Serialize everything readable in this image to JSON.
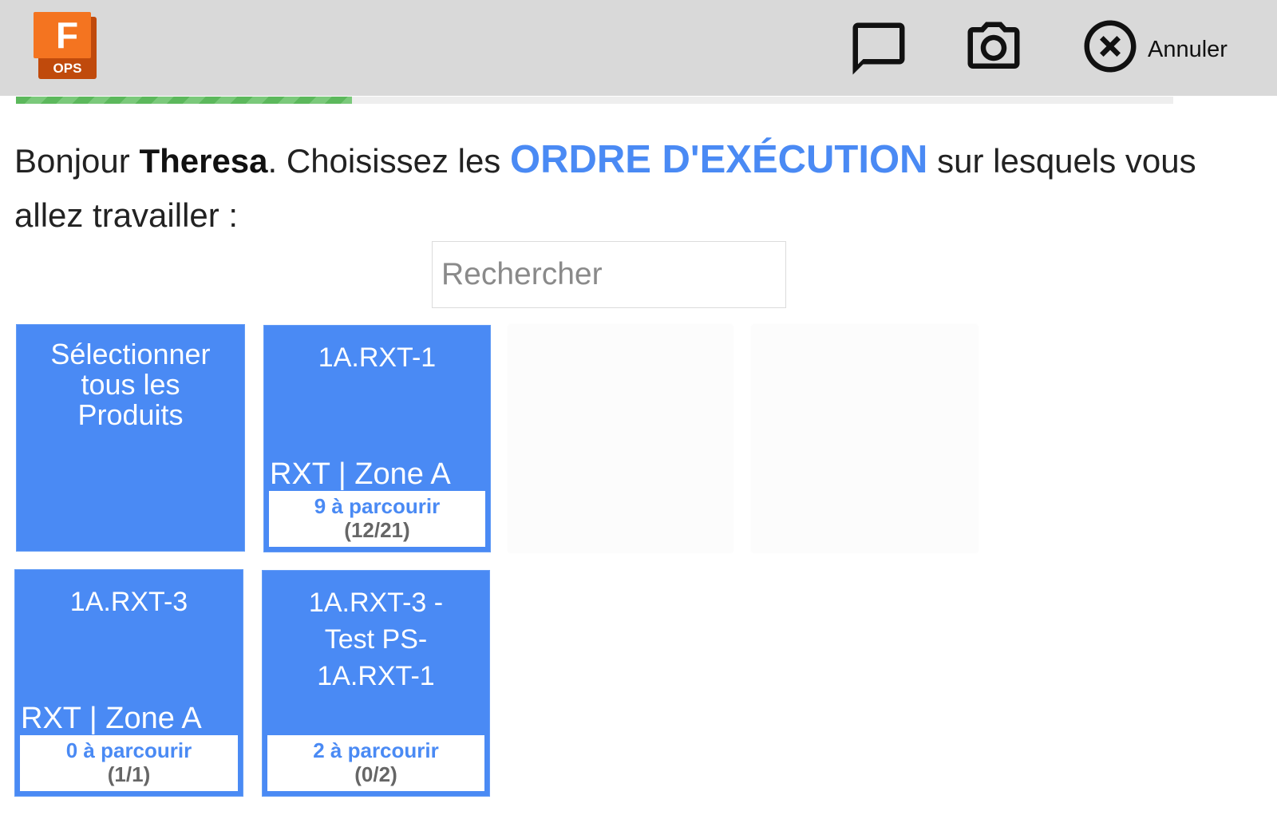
{
  "app": {
    "logo_letter": "F",
    "logo_product": "OPS",
    "brand_color": "#f47420"
  },
  "header": {
    "chat_icon": "chat-bubble-icon",
    "camera_icon": "camera-icon",
    "cancel_icon": "close-circle-icon",
    "cancel_label": "Annuler"
  },
  "progress": {
    "value": 0.29
  },
  "greeting": {
    "prefix": "Bonjour ",
    "user_name": "Theresa",
    "middle": ". Choisissez les ",
    "entity": "ORDRE D'EXÉCUTION",
    "suffix": " sur lesquels vous allez travailler :"
  },
  "search": {
    "placeholder": "Rechercher",
    "value": ""
  },
  "select_all_tile": {
    "label": "Sélectionner tous les Produits"
  },
  "orders": [
    {
      "title": "1A.RXT-1",
      "zone": "RXT | Zone A",
      "remaining": "9 à parcourir",
      "count": "(12/21)"
    },
    {
      "title": "1A.RXT-3",
      "zone": "RXT | Zone A",
      "remaining": "0 à parcourir",
      "count": "(1/1)"
    },
    {
      "title_lines": [
        "1A.RXT-3 -",
        "Test PS-",
        "1A.RXT-1"
      ],
      "remaining": "2 à parcourir",
      "count": "(0/2)"
    }
  ],
  "colors": {
    "accent": "#4a8af4",
    "tile": "#4a8af4",
    "header_bg": "#d9d9d9",
    "count_text": "#666666",
    "progress": "#5cb85c"
  }
}
